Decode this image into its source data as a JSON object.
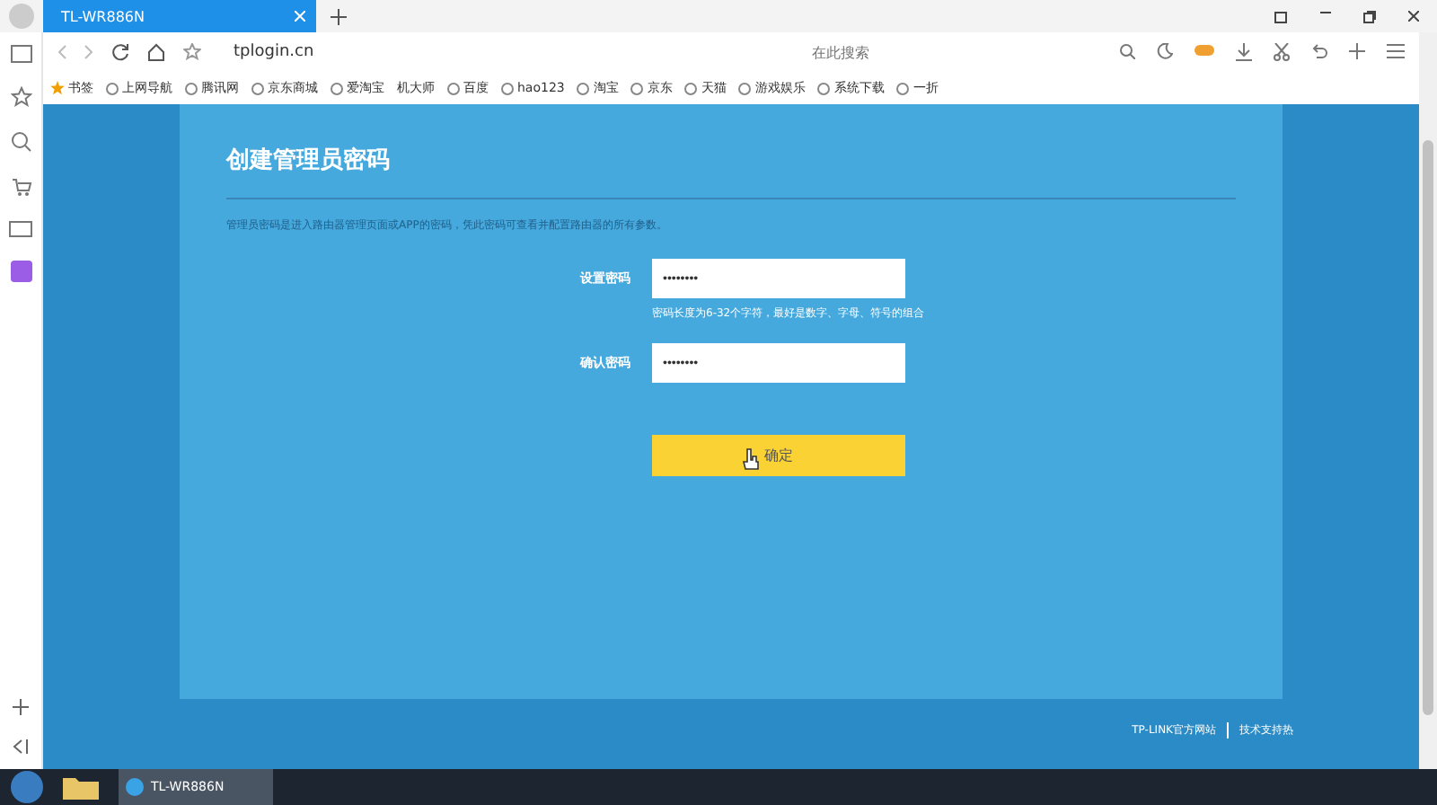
{
  "browser": {
    "tab": {
      "title": "TL-WR886N"
    },
    "address": "tplogin.cn",
    "search_placeholder": "在此搜索",
    "bookmarks": [
      {
        "label": "书签",
        "kind": "star"
      },
      {
        "label": "上网导航",
        "kind": "globe"
      },
      {
        "label": "腾讯网",
        "kind": "globe"
      },
      {
        "label": "京东商城",
        "kind": "globe"
      },
      {
        "label": "爱淘宝",
        "kind": "globe"
      },
      {
        "label": "机大师",
        "kind": "none"
      },
      {
        "label": "百度",
        "kind": "globe"
      },
      {
        "label": "hao123",
        "kind": "globe"
      },
      {
        "label": "淘宝",
        "kind": "globe"
      },
      {
        "label": "京东",
        "kind": "globe"
      },
      {
        "label": "天猫",
        "kind": "globe"
      },
      {
        "label": "游戏娱乐",
        "kind": "globe"
      },
      {
        "label": "系统下载",
        "kind": "globe"
      },
      {
        "label": "一折",
        "kind": "globe"
      }
    ]
  },
  "page": {
    "title": "创建管理员密码",
    "description": "管理员密码是进入路由器管理页面或APP的密码，凭此密码可查看并配置路由器的所有参数。",
    "fields": [
      {
        "label": "设置密码",
        "value": "••••••••",
        "hint": "密码长度为6-32个字符，最好是数字、字母、符号的组合"
      },
      {
        "label": "确认密码",
        "value": "••••••••"
      }
    ],
    "button": "确定",
    "footer": [
      "TP-LINK官方网站",
      "技术支持热"
    ]
  },
  "taskbar": {
    "window": "TL-WR886N"
  }
}
